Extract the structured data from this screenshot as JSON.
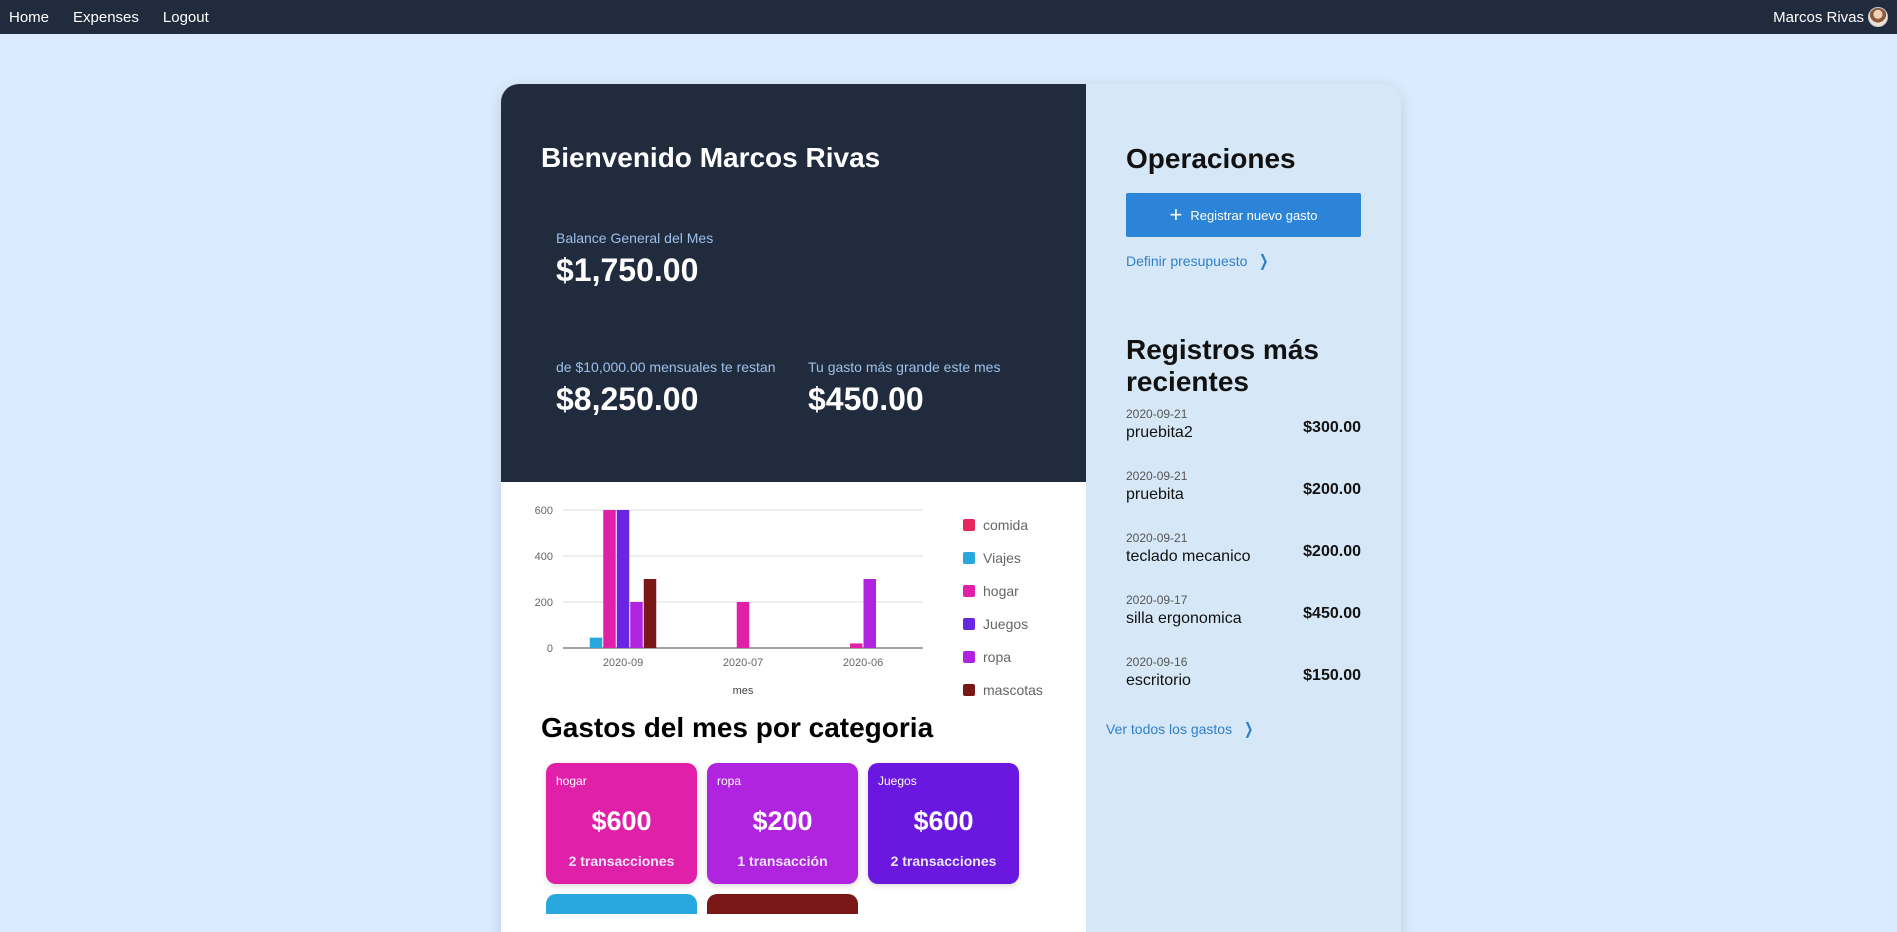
{
  "nav": {
    "links": [
      "Home",
      "Expenses",
      "Logout"
    ],
    "user_name": "Marcos Rivas"
  },
  "hero": {
    "title": "Bienvenido Marcos Rivas",
    "balance_label": "Balance General del Mes",
    "balance_value": "$1,750.00",
    "remaining_label": "de $10,000.00 mensuales te restan",
    "remaining_value": "$8,250.00",
    "largest_label": "Tu gasto más grande este mes",
    "largest_value": "$450.00"
  },
  "chart_data": {
    "type": "bar",
    "categories": [
      "2020-09",
      "2020-07",
      "2020-06"
    ],
    "xlabel": "mes",
    "ylabel": "",
    "ylim": [
      0,
      600
    ],
    "yticks": [
      0,
      200,
      400,
      600
    ],
    "grid": true,
    "legend_position": "right",
    "series": [
      {
        "name": "comida",
        "color": "#e8265e",
        "values": [
          0,
          0,
          0
        ]
      },
      {
        "name": "Viajes",
        "color": "#29a8e0",
        "values": [
          45,
          0,
          0
        ]
      },
      {
        "name": "hogar",
        "color": "#e020a8",
        "values": [
          600,
          200,
          20
        ]
      },
      {
        "name": "Juegos",
        "color": "#6a25e0",
        "values": [
          600,
          0,
          0
        ]
      },
      {
        "name": "ropa",
        "color": "#b024e0",
        "values": [
          200,
          0,
          300
        ]
      },
      {
        "name": "mascotas",
        "color": "#7a1818",
        "values": [
          300,
          0,
          0
        ]
      }
    ]
  },
  "categories": {
    "title": "Gastos del mes por categoria",
    "cards": [
      {
        "name": "hogar",
        "amount": "$600",
        "count": "2 transacciones",
        "color": "#e020a8"
      },
      {
        "name": "ropa",
        "amount": "$200",
        "count": "1 transacción",
        "color": "#b024e0"
      },
      {
        "name": "Juegos",
        "amount": "$600",
        "count": "2 transacciones",
        "color": "#6a18e0"
      }
    ],
    "stub_colors": [
      "#29a8e0",
      "#7a1818"
    ]
  },
  "operations": {
    "title": "Operaciones",
    "new_expense_label": "Registrar nuevo gasto",
    "budget_link": "Definir presupuesto"
  },
  "recent": {
    "title": "Registros más recientes",
    "items": [
      {
        "date": "2020-09-21",
        "name": "pruebita2",
        "amount": "$300.00"
      },
      {
        "date": "2020-09-21",
        "name": "pruebita",
        "amount": "$200.00"
      },
      {
        "date": "2020-09-21",
        "name": "teclado mecanico",
        "amount": "$200.00"
      },
      {
        "date": "2020-09-17",
        "name": "silla ergonomica",
        "amount": "$450.00"
      },
      {
        "date": "2020-09-16",
        "name": "escritorio",
        "amount": "$150.00"
      }
    ],
    "all_link": "Ver todos los gastos"
  },
  "icons": {
    "plus": "plus-icon",
    "chevron": "chevron-right-icon",
    "avatar": "avatar"
  }
}
